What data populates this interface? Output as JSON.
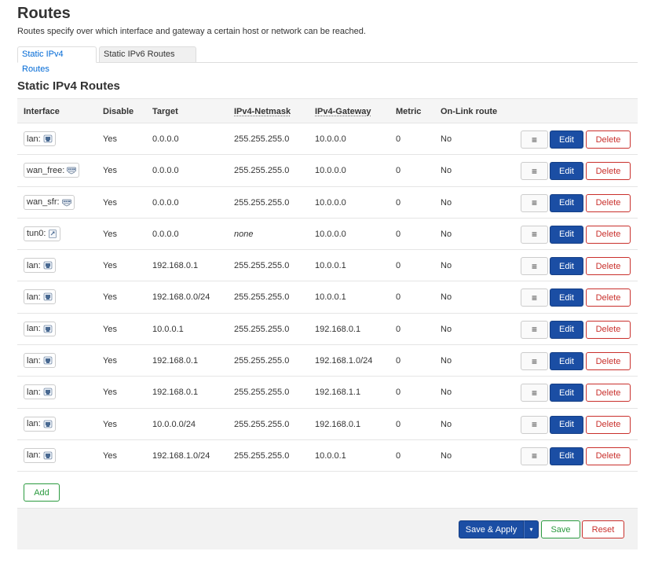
{
  "page": {
    "title": "Routes",
    "description": "Routes specify over which interface and gateway a certain host or network can be reached."
  },
  "tabs": [
    {
      "label": "Static IPv4 Routes",
      "active": true
    },
    {
      "label": "Static IPv6 Routes",
      "active": false
    }
  ],
  "section": {
    "title": "Static IPv4 Routes"
  },
  "columns": {
    "interface": "Interface",
    "disable": "Disable",
    "target": "Target",
    "netmask": "IPv4-Netmask",
    "gateway": "IPv4-Gateway",
    "metric": "Metric",
    "onlink": "On-Link route"
  },
  "row_buttons": {
    "menu": "≡",
    "edit": "Edit",
    "delete": "Delete"
  },
  "rows": [
    {
      "interface": "lan:",
      "icon": "ethernet-port-icon",
      "disable": "Yes",
      "target": "0.0.0.0",
      "netmask": "255.255.255.0",
      "gateway": "10.0.0.0",
      "metric": "0",
      "onlink": "No"
    },
    {
      "interface": "wan_free:",
      "icon": "switch-icon",
      "disable": "Yes",
      "target": "0.0.0.0",
      "netmask": "255.255.255.0",
      "gateway": "10.0.0.0",
      "metric": "0",
      "onlink": "No"
    },
    {
      "interface": "wan_sfr:",
      "icon": "switch-icon",
      "disable": "Yes",
      "target": "0.0.0.0",
      "netmask": "255.255.255.0",
      "gateway": "10.0.0.0",
      "metric": "0",
      "onlink": "No"
    },
    {
      "interface": "tun0:",
      "icon": "tunnel-icon",
      "disable": "Yes",
      "target": "0.0.0.0",
      "netmask": "none",
      "gateway": "10.0.0.0",
      "metric": "0",
      "onlink": "No"
    },
    {
      "interface": "lan:",
      "icon": "ethernet-port-icon",
      "disable": "Yes",
      "target": "192.168.0.1",
      "netmask": "255.255.255.0",
      "gateway": "10.0.0.1",
      "metric": "0",
      "onlink": "No"
    },
    {
      "interface": "lan:",
      "icon": "ethernet-port-icon",
      "disable": "Yes",
      "target": "192.168.0.0/24",
      "netmask": "255.255.255.0",
      "gateway": "10.0.0.1",
      "metric": "0",
      "onlink": "No"
    },
    {
      "interface": "lan:",
      "icon": "ethernet-port-icon",
      "disable": "Yes",
      "target": "10.0.0.1",
      "netmask": "255.255.255.0",
      "gateway": "192.168.0.1",
      "metric": "0",
      "onlink": "No"
    },
    {
      "interface": "lan:",
      "icon": "ethernet-port-icon",
      "disable": "Yes",
      "target": "192.168.0.1",
      "netmask": "255.255.255.0",
      "gateway": "192.168.1.0/24",
      "metric": "0",
      "onlink": "No"
    },
    {
      "interface": "lan:",
      "icon": "ethernet-port-icon",
      "disable": "Yes",
      "target": "192.168.0.1",
      "netmask": "255.255.255.0",
      "gateway": "192.168.1.1",
      "metric": "0",
      "onlink": "No"
    },
    {
      "interface": "lan:",
      "icon": "ethernet-port-icon",
      "disable": "Yes",
      "target": "10.0.0.0/24",
      "netmask": "255.255.255.0",
      "gateway": "192.168.0.1",
      "metric": "0",
      "onlink": "No"
    },
    {
      "interface": "lan:",
      "icon": "ethernet-port-icon",
      "disable": "Yes",
      "target": "192.168.1.0/24",
      "netmask": "255.255.255.0",
      "gateway": "10.0.0.1",
      "metric": "0",
      "onlink": "No"
    }
  ],
  "actions": {
    "add": "Add",
    "save_apply": "Save & Apply",
    "save_apply_caret": "▾",
    "save": "Save",
    "reset": "Reset"
  },
  "colors": {
    "primary": "#1b4ea4",
    "positive": "#2b9a3f",
    "negative": "#c9302c",
    "tab_active_text": "#0069d6"
  }
}
